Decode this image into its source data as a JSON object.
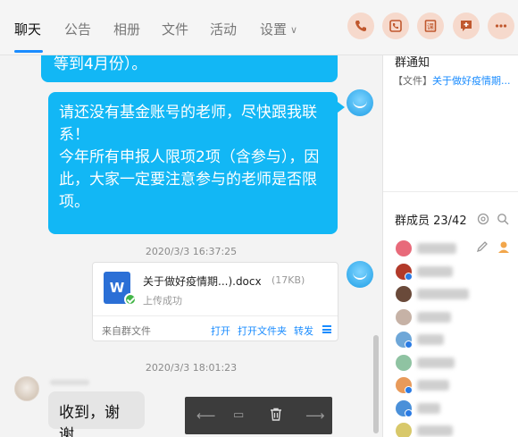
{
  "tabs": [
    {
      "label": "聊天",
      "active": true
    },
    {
      "label": "公告",
      "active": false
    },
    {
      "label": "相册",
      "active": false
    },
    {
      "label": "文件",
      "active": false
    },
    {
      "label": "活动",
      "active": false
    },
    {
      "label": "设置",
      "active": false
    }
  ],
  "top_actions": [
    "phone-icon",
    "video-call-icon",
    "classroom-icon",
    "add-message-icon",
    "more-icon"
  ],
  "accent_color": "#1a8cff",
  "bubble_color": "#12b7f5",
  "messages": {
    "top_fragment": "等到4月份）。",
    "main_lines": [
      "请还没有基金账号的老师，尽快跟我联",
      "系！",
      "今年所有申报人限项2项（含参与），因",
      "此，大家一定要注意参与的老师是否限",
      "项。"
    ],
    "time_1": "2020/3/3 16:37:25",
    "file": {
      "name": "关于做好疫情期...).docx",
      "size": "(17KB)",
      "status": "上传成功",
      "source": "来自群文件",
      "open": "打开",
      "open_folder": "打开文件夹",
      "forward": "转发",
      "icon_letter": "W"
    },
    "time_2": "2020/3/3 18:01:23",
    "reply": "收到，谢谢"
  },
  "sidebar": {
    "notice_title": "群通知",
    "notice_tag": "【文件】",
    "notice_text": "关于做好疫情期...",
    "members_title": "群成员 23/42"
  },
  "members": [
    {
      "avatar_color": "#e86a7a",
      "badge": false
    },
    {
      "avatar_color": "#b23a2a",
      "badge": true
    },
    {
      "avatar_color": "#6a4a3a",
      "badge": false
    },
    {
      "avatar_color": "#c6b2a6",
      "badge": false
    },
    {
      "avatar_color": "#6ea7d8",
      "badge": true
    },
    {
      "avatar_color": "#8fc3a2",
      "badge": false
    },
    {
      "avatar_color": "#e89a5a",
      "badge": true
    },
    {
      "avatar_color": "#4a90d9",
      "badge": true
    },
    {
      "avatar_color": "#d8c86a",
      "badge": false
    }
  ]
}
